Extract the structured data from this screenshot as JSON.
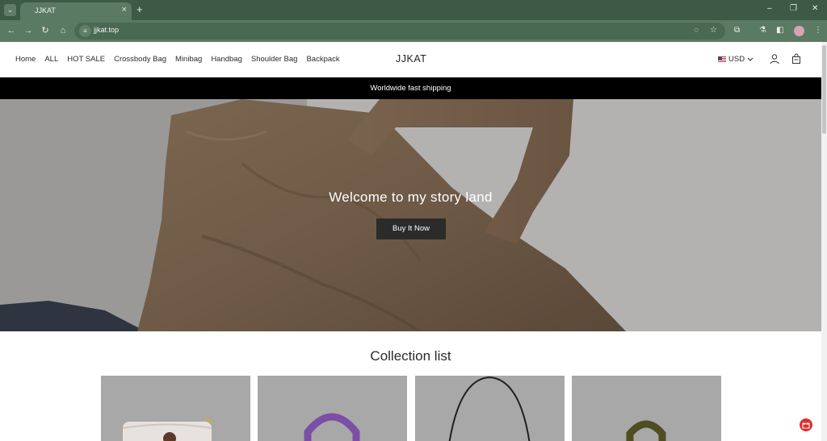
{
  "browser": {
    "tab_title": "JJKAT",
    "url": "jjkat.top",
    "tab_search_icon": "chevron-down-icon",
    "accent_color": "#5b7a63"
  },
  "header": {
    "nav_items": [
      "Home",
      "ALL",
      "HOT SALE",
      "Crossbody Bag",
      "Minibag",
      "Handbag",
      "Shoulder Bag",
      "Backpack"
    ],
    "logo": "JJKAT",
    "currency": "USD"
  },
  "announcement": "Worldwide fast shipping",
  "hero": {
    "title": "Welcome to my story land",
    "button": "Buy It Now"
  },
  "collection": {
    "title": "Collection list"
  }
}
